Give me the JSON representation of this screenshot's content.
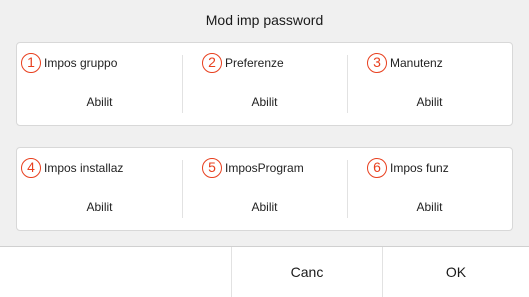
{
  "dialog": {
    "title": "Mod imp password",
    "accent_color": "#e83f1e"
  },
  "rows": [
    [
      {
        "num": "1",
        "label": "Impos gruppo",
        "value": "Abilit"
      },
      {
        "num": "2",
        "label": "Preferenze",
        "value": "Abilit"
      },
      {
        "num": "3",
        "label": "Manutenz",
        "value": "Abilit"
      }
    ],
    [
      {
        "num": "4",
        "label": "Impos installaz",
        "value": "Abilit"
      },
      {
        "num": "5",
        "label": "ImposProgram",
        "value": "Abilit"
      },
      {
        "num": "6",
        "label": "Impos funz",
        "value": "Abilit"
      }
    ]
  ],
  "footer": {
    "cancel_label": "Canc",
    "ok_label": "OK"
  }
}
